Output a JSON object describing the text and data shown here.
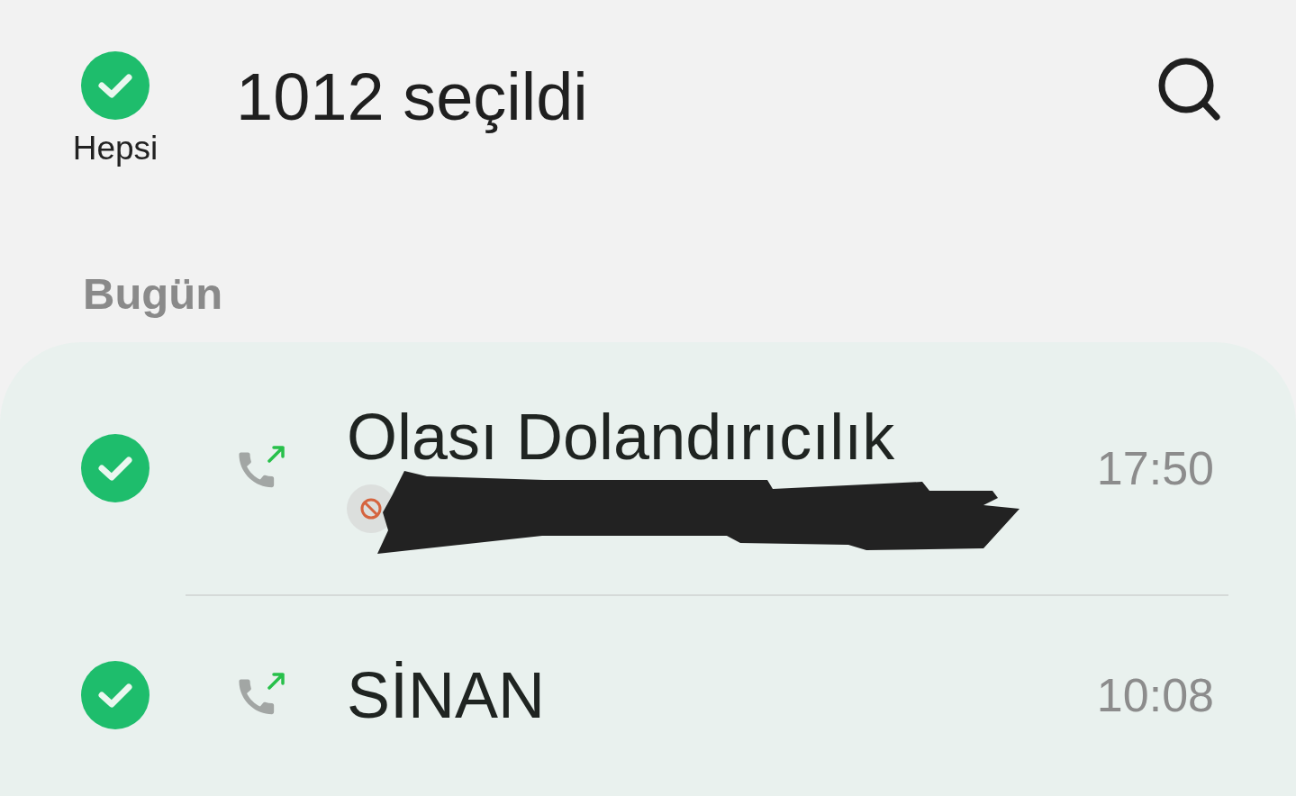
{
  "header": {
    "select_all": {
      "label": "Hepsi",
      "checked": true
    },
    "title": "1012 seçildi"
  },
  "sections": [
    {
      "title": "Bugün",
      "calls": [
        {
          "name": "Olası Dolandırıcılık",
          "time": "17:50",
          "checked": true,
          "kind": "outgoing",
          "blocked": true,
          "redacted": true
        },
        {
          "name": "SİNAN",
          "time": "10:08",
          "checked": true,
          "kind": "outgoing",
          "blocked": false,
          "redacted": false
        }
      ]
    }
  ]
}
